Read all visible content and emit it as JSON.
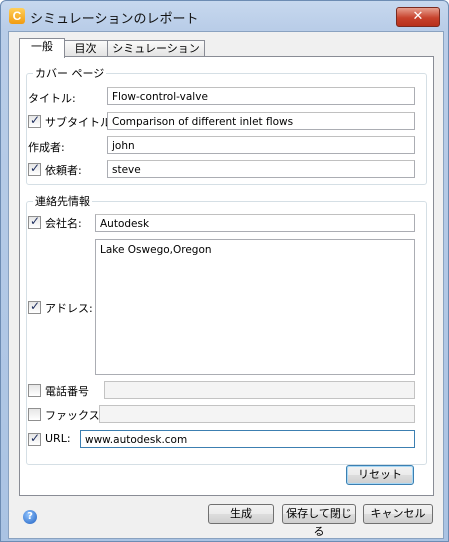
{
  "window": {
    "title": "シミュレーションのレポート",
    "app_icon_glyph": "C",
    "close_glyph": "✕"
  },
  "tabs": [
    {
      "label": "一般",
      "active": true
    },
    {
      "label": "目次",
      "active": false
    },
    {
      "label": "シミュレーション",
      "active": false
    }
  ],
  "cover": {
    "legend": "カバー ページ",
    "title_label": "タイトル:",
    "title_value": "Flow-control-valve",
    "subtitle_label": "サブタイトル",
    "subtitle_checked": true,
    "subtitle_value": "Comparison of different inlet flows",
    "author_label": "作成者:",
    "author_value": "john",
    "client_label": "依頼者:",
    "client_checked": true,
    "client_value": "steve"
  },
  "contact": {
    "legend": "連絡先情報",
    "company_label": "会社名:",
    "company_checked": true,
    "company_value": "Autodesk",
    "address_label": "アドレス:",
    "address_checked": true,
    "address_value": "Lake Oswego,Oregon",
    "phone_label": "電話番号",
    "phone_checked": false,
    "phone_value": "",
    "fax_label": "ファックス:",
    "fax_checked": false,
    "fax_value": "",
    "url_label": "URL:",
    "url_checked": true,
    "url_value": "www.autodesk.com"
  },
  "buttons": {
    "reset": "リセット",
    "generate": "生成",
    "save_close": "保存して閉じる",
    "cancel": "キャンセル"
  },
  "icons": {
    "help": "?"
  },
  "colors": {
    "title_bar": "#b9cde8",
    "close_button": "#c7422c",
    "focus_border": "#3c7fb1"
  }
}
